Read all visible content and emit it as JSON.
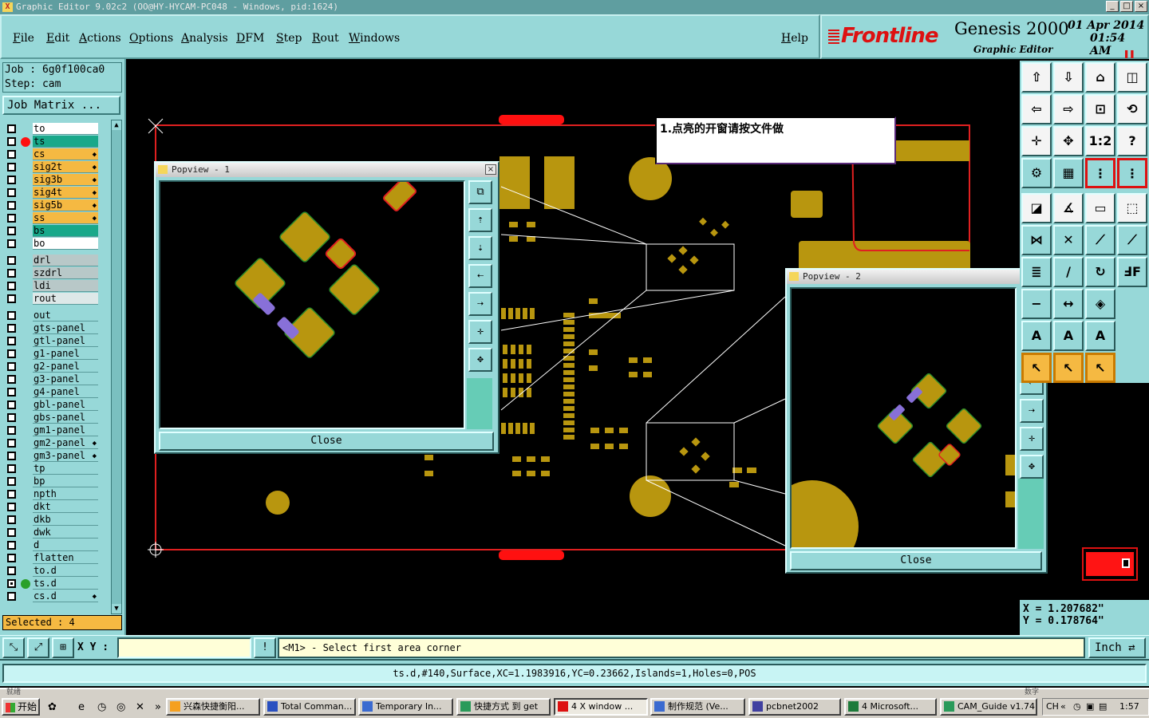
{
  "window": {
    "title": "Graphic Editor 9.02c2 (OO@HY-HYCAM-PC048 - Windows, pid:1624)"
  },
  "menu": {
    "items": [
      "File",
      "Edit",
      "Actions",
      "Options",
      "Analysis",
      "DFM",
      "Step",
      "Rout",
      "Windows"
    ],
    "help": "Help"
  },
  "logo": {
    "brand": "Frontline",
    "product": "Genesis 2000",
    "subtitle": "Graphic Editor",
    "date": "01 Apr 2014",
    "time": "01:54 AM",
    "brand_color": "#dd1111"
  },
  "job": {
    "job_line": "Job : 6g0f100ca0",
    "step_line": "Step: cam",
    "matrix_button": "Job Matrix ..."
  },
  "layers": [
    {
      "name": "to",
      "style": "white"
    },
    {
      "name": "ts",
      "style": "green",
      "mark": "red-dot"
    },
    {
      "name": "cs",
      "style": "orange",
      "flag": true
    },
    {
      "name": "sig2t",
      "style": "orange",
      "flag": true
    },
    {
      "name": "sig3b",
      "style": "orange",
      "flag": true
    },
    {
      "name": "sig4t",
      "style": "orange",
      "flag": true
    },
    {
      "name": "sig5b",
      "style": "orange",
      "flag": true
    },
    {
      "name": "ss",
      "style": "orange",
      "flag": true
    },
    {
      "name": "bs",
      "style": "green"
    },
    {
      "name": "bo",
      "style": "white"
    },
    {
      "name": "drl",
      "style": "grey"
    },
    {
      "name": "szdrl",
      "style": "grey"
    },
    {
      "name": "ldi",
      "style": "grey"
    },
    {
      "name": "rout",
      "style": "light"
    },
    {
      "name": "out",
      "style": "teal"
    },
    {
      "name": "gts-panel",
      "style": "teal"
    },
    {
      "name": "gtl-panel",
      "style": "teal"
    },
    {
      "name": "g1-panel",
      "style": "teal"
    },
    {
      "name": "g2-panel",
      "style": "teal"
    },
    {
      "name": "g3-panel",
      "style": "teal"
    },
    {
      "name": "g4-panel",
      "style": "teal"
    },
    {
      "name": "gbl-panel",
      "style": "teal"
    },
    {
      "name": "gbs-panel",
      "style": "teal"
    },
    {
      "name": "gm1-panel",
      "style": "teal"
    },
    {
      "name": "gm2-panel",
      "style": "teal",
      "flag": true
    },
    {
      "name": "gm3-panel",
      "style": "teal",
      "flag": true
    },
    {
      "name": "tp",
      "style": "teal"
    },
    {
      "name": "bp",
      "style": "teal"
    },
    {
      "name": "npth",
      "style": "teal"
    },
    {
      "name": "dkt",
      "style": "teal"
    },
    {
      "name": "dkb",
      "style": "teal"
    },
    {
      "name": "dwk",
      "style": "teal"
    },
    {
      "name": "d",
      "style": "teal"
    },
    {
      "name": "flatten",
      "style": "teal"
    },
    {
      "name": "to.d",
      "style": "teal"
    },
    {
      "name": "ts.d",
      "style": "teal",
      "mark": "green-arrow",
      "checked": true
    },
    {
      "name": "cs.d",
      "style": "teal",
      "flag": true
    }
  ],
  "selected_text": "Selected : 4",
  "note": {
    "text": "1.点亮的开窗请按文件做"
  },
  "popview1": {
    "title": "Popview - 1",
    "close_label": "Close"
  },
  "popview2": {
    "title": "Popview - 2",
    "close_label": "Close"
  },
  "coords": {
    "x_line": "X = 1.207682\"",
    "y_line": "Y = 0.178764\""
  },
  "bottom": {
    "xy_label": "X Y :",
    "xy_value": "",
    "prompt": "<M1> - Select first area corner",
    "unit": "Inch"
  },
  "status": {
    "text": "ts.d,#140,Surface,XC=1.1983916,YC=0.23662,Islands=1,Holes=0,POS"
  },
  "taskbar": {
    "hint_left": "就绪",
    "hint_right": "数字",
    "start": "开始",
    "tasks": [
      {
        "label": "兴森快捷衡阳...",
        "icon": "star-icon"
      },
      {
        "label": "Total Comman...",
        "icon": "floppy-icon"
      },
      {
        "label": "Temporary In...",
        "icon": "doc-icon"
      },
      {
        "label": "快捷方式 到 get",
        "icon": "globe-icon"
      },
      {
        "label": "4 X window ...",
        "icon": "x-icon",
        "active": true
      },
      {
        "label": "制作规范 (Ve...",
        "icon": "doc-icon"
      },
      {
        "label": "pcbnet2002",
        "icon": "app-icon"
      },
      {
        "label": "4 Microsoft...",
        "icon": "excel-icon"
      },
      {
        "label": "CAM_Guide v1.74",
        "icon": "globe-icon"
      }
    ],
    "clock": "1:57"
  }
}
